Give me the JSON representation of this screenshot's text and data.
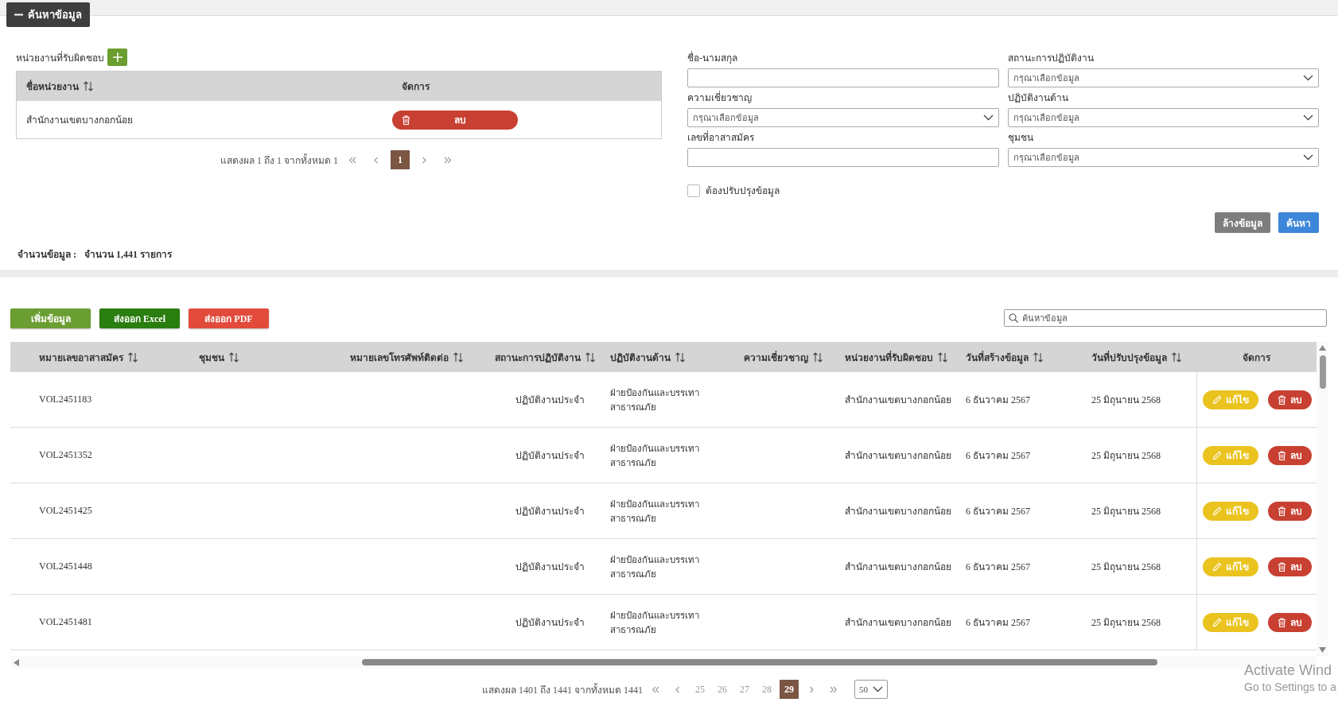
{
  "search_tab": {
    "label": "ค้นหาข้อมูล",
    "expanded": true
  },
  "responsible_units": {
    "label": "หน่วยงานที่รับผิดชอบ",
    "columns": [
      {
        "label": "ชื่อหน่วยงาน",
        "sortable": true
      },
      {
        "label": "จัดการ",
        "sortable": false
      }
    ],
    "rows": [
      {
        "name": "สำนักงานเขตบางกอกน้อย",
        "action": "ลบ"
      }
    ],
    "pagination": {
      "summary": "แสดงผล 1 ถึง 1 จากทั้งหมด 1",
      "pages": [
        {
          "label": "1",
          "selected": true
        }
      ]
    }
  },
  "filters": [
    {
      "label": "ชื่อ-นามสกุล",
      "kind": "text"
    },
    {
      "label": "สถานะการปฏิบัติงาน",
      "kind": "select",
      "placeholder": "กรุณาเลือกข้อมูล"
    },
    {
      "label": "ความเชี่ยวชาญ",
      "kind": "select",
      "placeholder": "กรุณาเลือกข้อมูล"
    },
    {
      "label": "ปฏิบัติงานด้าน",
      "kind": "select",
      "placeholder": "กรุณาเลือกข้อมูล"
    },
    {
      "label": "เลขที่อาสาสมัคร",
      "kind": "text"
    },
    {
      "label": "ชุมชน",
      "kind": "select",
      "placeholder": "กรุณาเลือกข้อมูล"
    }
  ],
  "needs_update": {
    "label": "ต้องปรับปรุงข้อมูล",
    "checked": false
  },
  "form_buttons": [
    {
      "label": "ล้างข้อมูล",
      "kind": "clear"
    },
    {
      "label": "ค้นหา",
      "kind": "search"
    }
  ],
  "record_count": {
    "label": "จำนวนข้อมูล :",
    "value": "จำนวน 1,441 รายการ"
  },
  "toolbar": [
    {
      "label": "เพิ่มข้อมูล",
      "kind": "add"
    },
    {
      "label": "ส่งออก Excel",
      "kind": "excel"
    },
    {
      "label": "ส่งออก PDF",
      "kind": "pdf"
    }
  ],
  "search": {
    "placeholder": "ค้นหาข้อมูล"
  },
  "table": {
    "columns": [
      {
        "label": "หมายเลขอาสาสมัคร",
        "sortable": true
      },
      {
        "label": "ชุมชน",
        "sortable": true
      },
      {
        "label": "หมายเลขโทรศัพท์ติดต่อ",
        "sortable": true
      },
      {
        "label": "สถานะการปฏิบัติงาน",
        "sortable": true
      },
      {
        "label": "ปฏิบัติงานด้าน",
        "sortable": true
      },
      {
        "label": "ความเชี่ยวชาญ",
        "sortable": true
      },
      {
        "label": "หน่วยงานที่รับผิดชอบ",
        "sortable": true
      },
      {
        "label": "วันที่สร้างข้อมูล",
        "sortable": true
      },
      {
        "label": "วันที่ปรับปรุงข้อมูล",
        "sortable": true
      },
      {
        "label": "จัดการ",
        "sortable": false
      }
    ],
    "rows": [
      {
        "volunteer_id": "VOL2451183",
        "status": "ปฏิบัติงานประจำ",
        "work_area": "ฝ่ายป้องกันและบรรเทาสาธารณภัย",
        "unit": "สำนักงานเขตบางกอกน้อย",
        "created": "6 ธันวาคม 2567",
        "updated": "25 มิถุนายน 2568",
        "edit": "แก้ไข",
        "delete": "ลบ"
      },
      {
        "volunteer_id": "VOL2451352",
        "status": "ปฏิบัติงานประจำ",
        "work_area": "ฝ่ายป้องกันและบรรเทาสาธารณภัย",
        "unit": "สำนักงานเขตบางกอกน้อย",
        "created": "6 ธันวาคม 2567",
        "updated": "25 มิถุนายน 2568",
        "edit": "แก้ไข",
        "delete": "ลบ"
      },
      {
        "volunteer_id": "VOL2451425",
        "status": "ปฏิบัติงานประจำ",
        "work_area": "ฝ่ายป้องกันและบรรเทาสาธารณภัย",
        "unit": "สำนักงานเขตบางกอกน้อย",
        "created": "6 ธันวาคม 2567",
        "updated": "25 มิถุนายน 2568",
        "edit": "แก้ไข",
        "delete": "ลบ"
      },
      {
        "volunteer_id": "VOL2451448",
        "status": "ปฏิบัติงานประจำ",
        "work_area": "ฝ่ายป้องกันและบรรเทาสาธารณภัย",
        "unit": "สำนักงานเขตบางกอกน้อย",
        "created": "6 ธันวาคม 2567",
        "updated": "25 มิถุนายน 2568",
        "edit": "แก้ไข",
        "delete": "ลบ"
      },
      {
        "volunteer_id": "VOL2451481",
        "status": "ปฏิบัติงานประจำ",
        "work_area": "ฝ่ายป้องกันและบรรเทาสาธารณภัย",
        "unit": "สำนักงานเขตบางกอกน้อย",
        "created": "6 ธันวาคม 2567",
        "updated": "25 มิถุนายน 2568",
        "edit": "แก้ไข",
        "delete": "ลบ"
      }
    ]
  },
  "pagination": {
    "summary": "แสดงผล 1401 ถึง 1441 จากทั้งหมด 1441",
    "pages": [
      {
        "label": "25",
        "selected": false
      },
      {
        "label": "26",
        "selected": false
      },
      {
        "label": "27",
        "selected": false
      },
      {
        "label": "28",
        "selected": false
      },
      {
        "label": "29",
        "selected": true
      }
    ],
    "page_size": "50"
  },
  "os_notice": {
    "title": "Activate Wind",
    "subtitle": "Go to Settings to a"
  }
}
